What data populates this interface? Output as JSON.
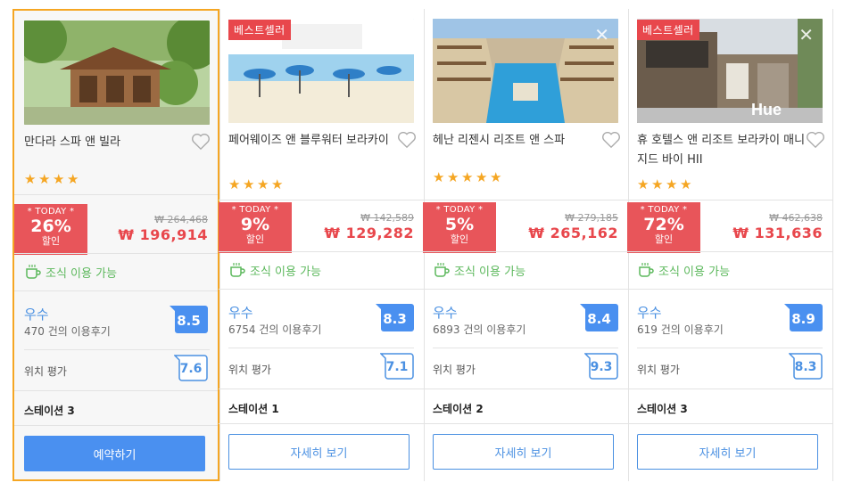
{
  "labels": {
    "bestseller": "베스트셀러",
    "today": "* TODAY *",
    "discount_word": "할인",
    "breakfast": "조식 이용 가능",
    "location": "위치 평가",
    "close_symbol": "✕"
  },
  "cards": [
    {
      "name": "만다라 스파 앤 빌라",
      "stars": 4,
      "bestseller": false,
      "discount": "26%",
      "original_price": "₩ 264,468",
      "price": "₩ 196,914",
      "rating_word": "우수",
      "reviews": "470 건의 이용후기",
      "score": "8.5",
      "location_score": "7.6",
      "station": "스테이션 3",
      "button": "예약하기",
      "selected": true
    },
    {
      "name": "페어웨이즈 앤 블루워터 보라카이",
      "stars": 4,
      "bestseller": true,
      "discount": "9%",
      "original_price": "₩ 142,589",
      "price": "₩ 129,282",
      "rating_word": "우수",
      "reviews": "6754 건의 이용후기",
      "score": "8.3",
      "location_score": "7.1",
      "station": "스테이션 1",
      "button": "자세히 보기",
      "selected": false
    },
    {
      "name": "헤난 리젠시 리조트 앤 스파",
      "stars": 5,
      "bestseller": false,
      "discount": "5%",
      "original_price": "₩ 279,185",
      "price": "₩ 265,162",
      "rating_word": "우수",
      "reviews": "6893 건의 이용후기",
      "score": "8.4",
      "location_score": "9.3",
      "station": "스테이션 2",
      "button": "자세히 보기",
      "selected": false
    },
    {
      "name": "휴 호텔스 앤 리조트 보라카이 매니지드 바이 HII",
      "stars": 4,
      "bestseller": true,
      "discount": "72%",
      "original_price": "₩ 462,638",
      "price": "₩ 131,636",
      "rating_word": "우수",
      "reviews": "619 건의 이용후기",
      "score": "8.9",
      "location_score": "8.3",
      "station": "스테이션 3",
      "button": "자세히 보기",
      "selected": false
    }
  ],
  "colors": {
    "accent_blue": "#4a90e2",
    "discount_red": "#e8555a",
    "price_red": "#e8474c",
    "star_orange": "#f5a623",
    "breakfast_green": "#5cb85c",
    "selected_border": "#f5a623"
  }
}
